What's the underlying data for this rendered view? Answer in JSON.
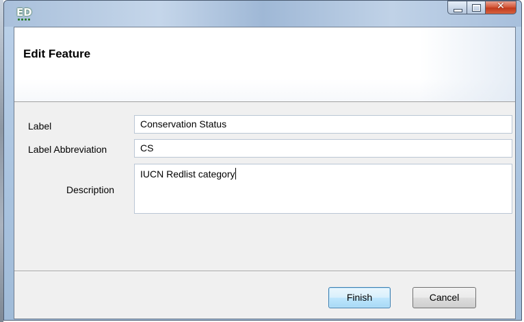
{
  "window": {
    "app_icon": "ED",
    "controls": {
      "minimize": "minimize-icon",
      "maximize": "maximize-icon",
      "close": "close-icon"
    }
  },
  "header": {
    "title": "Edit Feature"
  },
  "form": {
    "label": {
      "caption": "Label",
      "value": "Conservation Status"
    },
    "abbreviation": {
      "caption": "Label Abbreviation",
      "value": "CS"
    },
    "description": {
      "caption": "Description",
      "value": "IUCN Redlist category"
    }
  },
  "buttons": {
    "finish": "Finish",
    "cancel": "Cancel"
  },
  "colors": {
    "default_button_border": "#3c7fb1",
    "close_button": "#c23b1e",
    "dialog_bg": "#f0f0f0"
  }
}
